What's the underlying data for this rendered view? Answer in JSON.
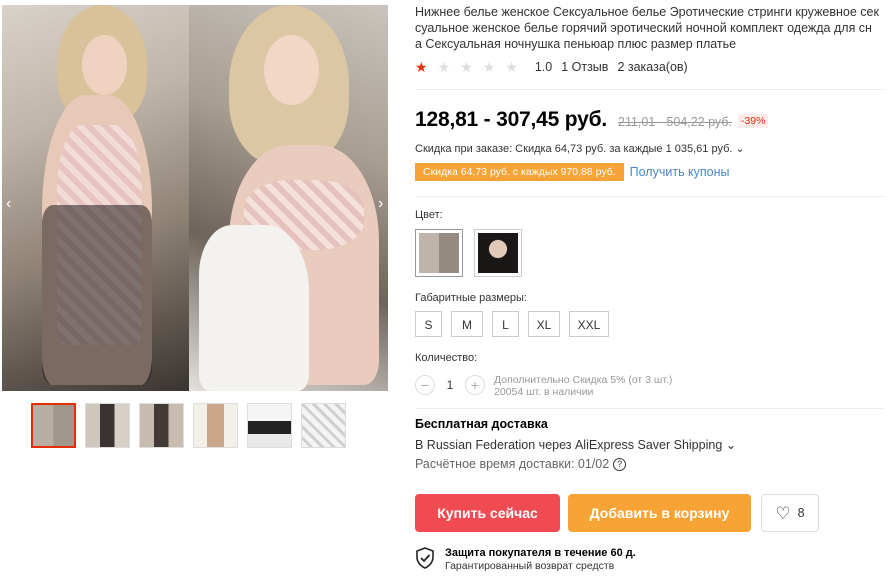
{
  "product": {
    "title": "Нижнее белье женское Сексуальное белье Эротические стринги кружевное сек\nсуальное женское белье горячий эротический ночной комплект одежда для сн\nа Сексуальная ночнушка пеньюар плюс размер платье",
    "rating_value": "1.0",
    "rating_stars": 1,
    "reviews": "1 Отзыв",
    "orders": "2 заказа(ов)"
  },
  "price": {
    "current": "128,81 - 307,45 руб.",
    "old": "211,01 - 504,22 руб.",
    "discount": "-39%"
  },
  "promo": {
    "order_discount": "Скидка при заказе: Скидка 64,73 руб. за каждые 1 035,61 руб. ⌄",
    "coupon": "Скидка 64,73 руб. с каждых 970,88 руб.",
    "get_coupons": "Получить купоны"
  },
  "options": {
    "color_label": "Цвет:",
    "size_label": "Габаритные размеры:",
    "sizes": [
      "S",
      "M",
      "L",
      "XL",
      "XXL"
    ],
    "quantity_label": "Количество:",
    "quantity": "1",
    "quantity_minus": "−",
    "quantity_plus": "+",
    "quantity_note_1": "Дополнительно Скидка 5% (от 3 шт.)",
    "quantity_note_2": "20054 шт. в наличии"
  },
  "shipping": {
    "title": "Бесплатная доставка",
    "line": "В Russian Federation через AliExpress Saver Shipping ⌄",
    "time": "Расчётное время доставки: 01/02",
    "help": "?"
  },
  "actions": {
    "buy": "Купить сейчас",
    "cart": "Добавить в корзину",
    "wishlist_count": "8"
  },
  "protection": {
    "title": "Защита покупателя в течение 60 д.",
    "subtitle": "Гарантированный возврат средств"
  },
  "gallery": {
    "arrow_left": "‹",
    "arrow_right": "›"
  },
  "colors": {
    "accent": "#e62e04",
    "buy": "#f04a53",
    "cart": "#f7a335",
    "link": "#4a86c5"
  }
}
